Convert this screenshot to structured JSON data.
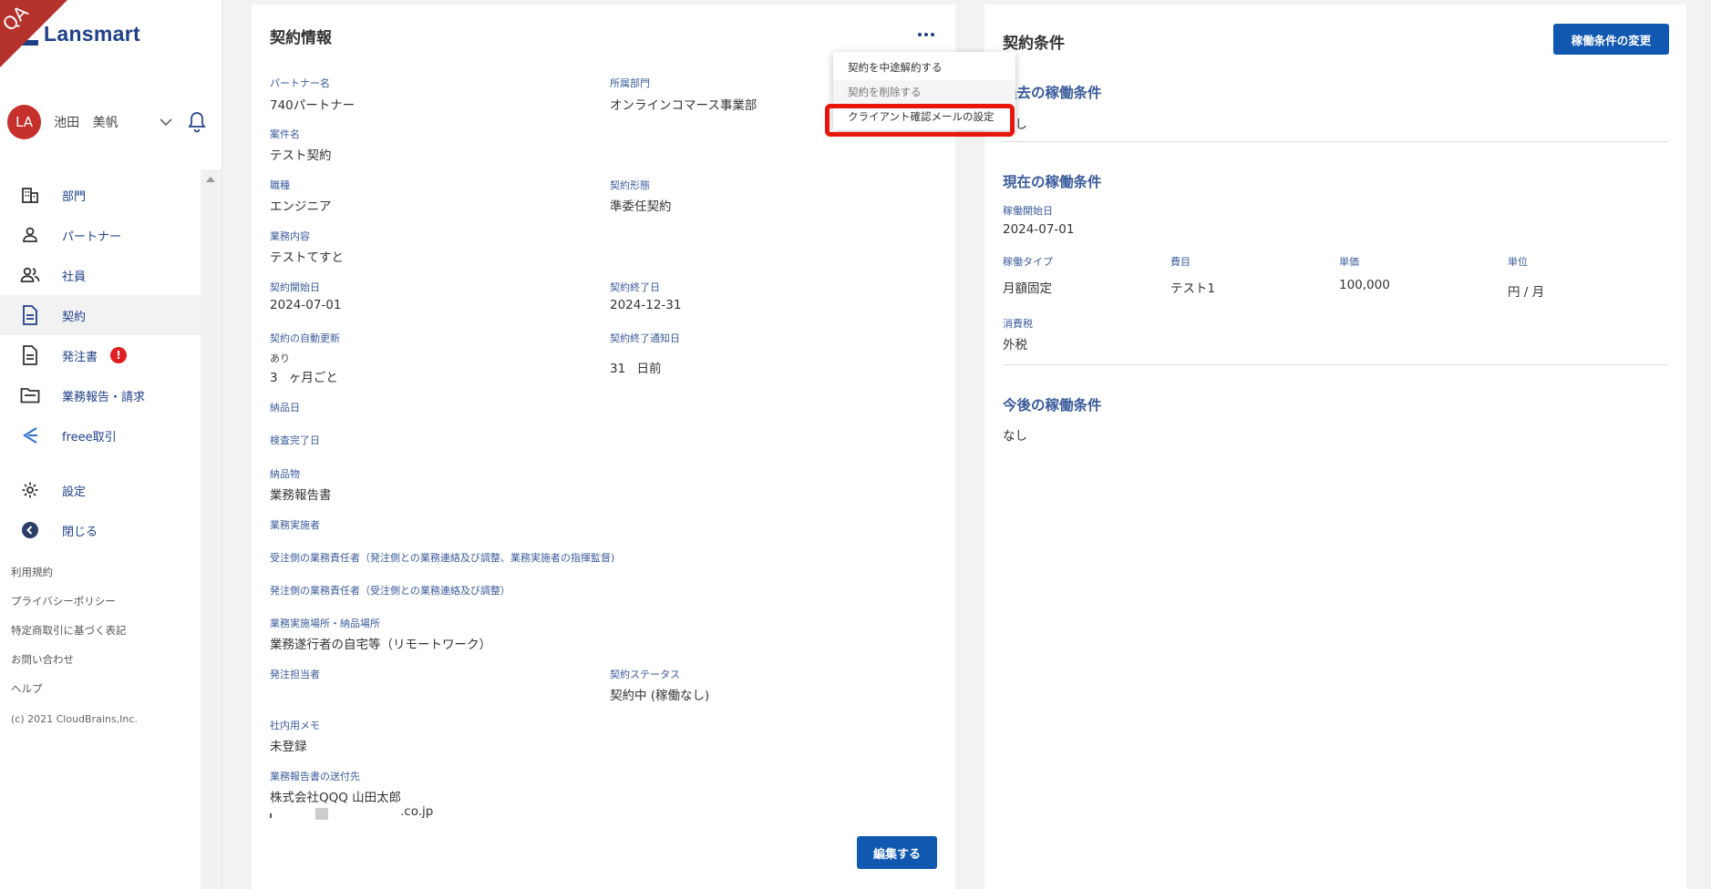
{
  "ribbon_text": "QA",
  "logo": {
    "text": "Lansmart"
  },
  "user": {
    "initials": "LA",
    "name": "池田 美帆"
  },
  "nav": {
    "items": [
      {
        "label": "部門",
        "icon": "building-icon"
      },
      {
        "label": "パートナー",
        "icon": "person-icon"
      },
      {
        "label": "社員",
        "icon": "people-icon"
      },
      {
        "label": "契約",
        "icon": "document-icon",
        "active": true
      },
      {
        "label": "発注書",
        "icon": "document-icon",
        "badge": "!"
      },
      {
        "label": "業務報告・請求",
        "icon": "folder-icon"
      },
      {
        "label": "freee取引",
        "icon": "freee-icon"
      },
      {
        "label": "設定",
        "icon": "gear-icon"
      },
      {
        "label": "閉じる",
        "icon": "back-arrow-icon"
      }
    ]
  },
  "footer": {
    "links": [
      "利用規約",
      "プライバシーポリシー",
      "特定商取引に基づく表記",
      "お問い合わせ",
      "ヘルプ"
    ],
    "copyright": "(c) 2021 CloudBrains,Inc."
  },
  "contract_info": {
    "title": "契約情報",
    "partner_name_label": "パートナー名",
    "partner_name": "740パートナー",
    "department_label": "所属部門",
    "department": "オンラインコマース事業部",
    "project_label": "案件名",
    "project": "テスト契約",
    "job_label": "職種",
    "job": "エンジニア",
    "form_label": "契約形態",
    "form": "準委任契約",
    "work_label": "業務内容",
    "work": "テストてすと",
    "start_label": "契約開始日",
    "start": "2024-07-01",
    "end_label": "契約終了日",
    "end": "2024-12-31",
    "auto_renew_label": "契約の自動更新",
    "auto_renew": "あり",
    "renew_period": "3 ヶ月ごと",
    "end_notice_label": "契約終了通知日",
    "end_notice": "31 日前",
    "delivery_date_label": "納品日",
    "inspection_label": "検査完了日",
    "deliverable_label": "納品物",
    "deliverable": "業務報告書",
    "implementer_label": "業務実施者",
    "receiver_manager_label": "受注側の業務責任者（発注側との業務連絡及び調整、業務実施者の指揮監督)",
    "orderer_manager_label": "発注側の業務責任者（受注側との業務連絡及び調整）",
    "place_label": "業務実施場所・納品場所",
    "place": "業務遂行者の自宅等（リモートワーク）",
    "order_person_label": "発注担当者",
    "status_label": "契約ステータス",
    "status": "契約中 (稼働なし)",
    "memo_label": "社内用メモ",
    "memo": "未登録",
    "report_dest_label": "業務報告書の送付先",
    "report_dest_company": "株式会社QQQ 山田太郎",
    "report_dest_email": ".co.jp",
    "edit_button": "編集する"
  },
  "menu": {
    "items": [
      "契約を中途解約する",
      "契約を削除する",
      "クライアント確認メールの設定"
    ]
  },
  "conditions": {
    "title": "契約条件",
    "change_button": "稼働条件の変更",
    "past_title": "過去の稼働条件",
    "past_value": "なし",
    "current_title": "現在の稼働条件",
    "start_label": "稼働開始日",
    "start": "2024-07-01",
    "type_label": "稼働タイプ",
    "type": "月額固定",
    "item_label": "費目",
    "item": "テスト1",
    "price_label": "単価",
    "price": "100,000",
    "unit_label": "単位",
    "unit": "円 / 月",
    "tax_label": "消費税",
    "tax": "外税",
    "future_title": "今後の稼働条件",
    "future_value": "なし"
  },
  "colors": {
    "brand": "#1e3f88",
    "button": "#1058b0",
    "label": "#3a5a9b",
    "highlight": "#e8150d",
    "ribbon": "#b5312c"
  }
}
